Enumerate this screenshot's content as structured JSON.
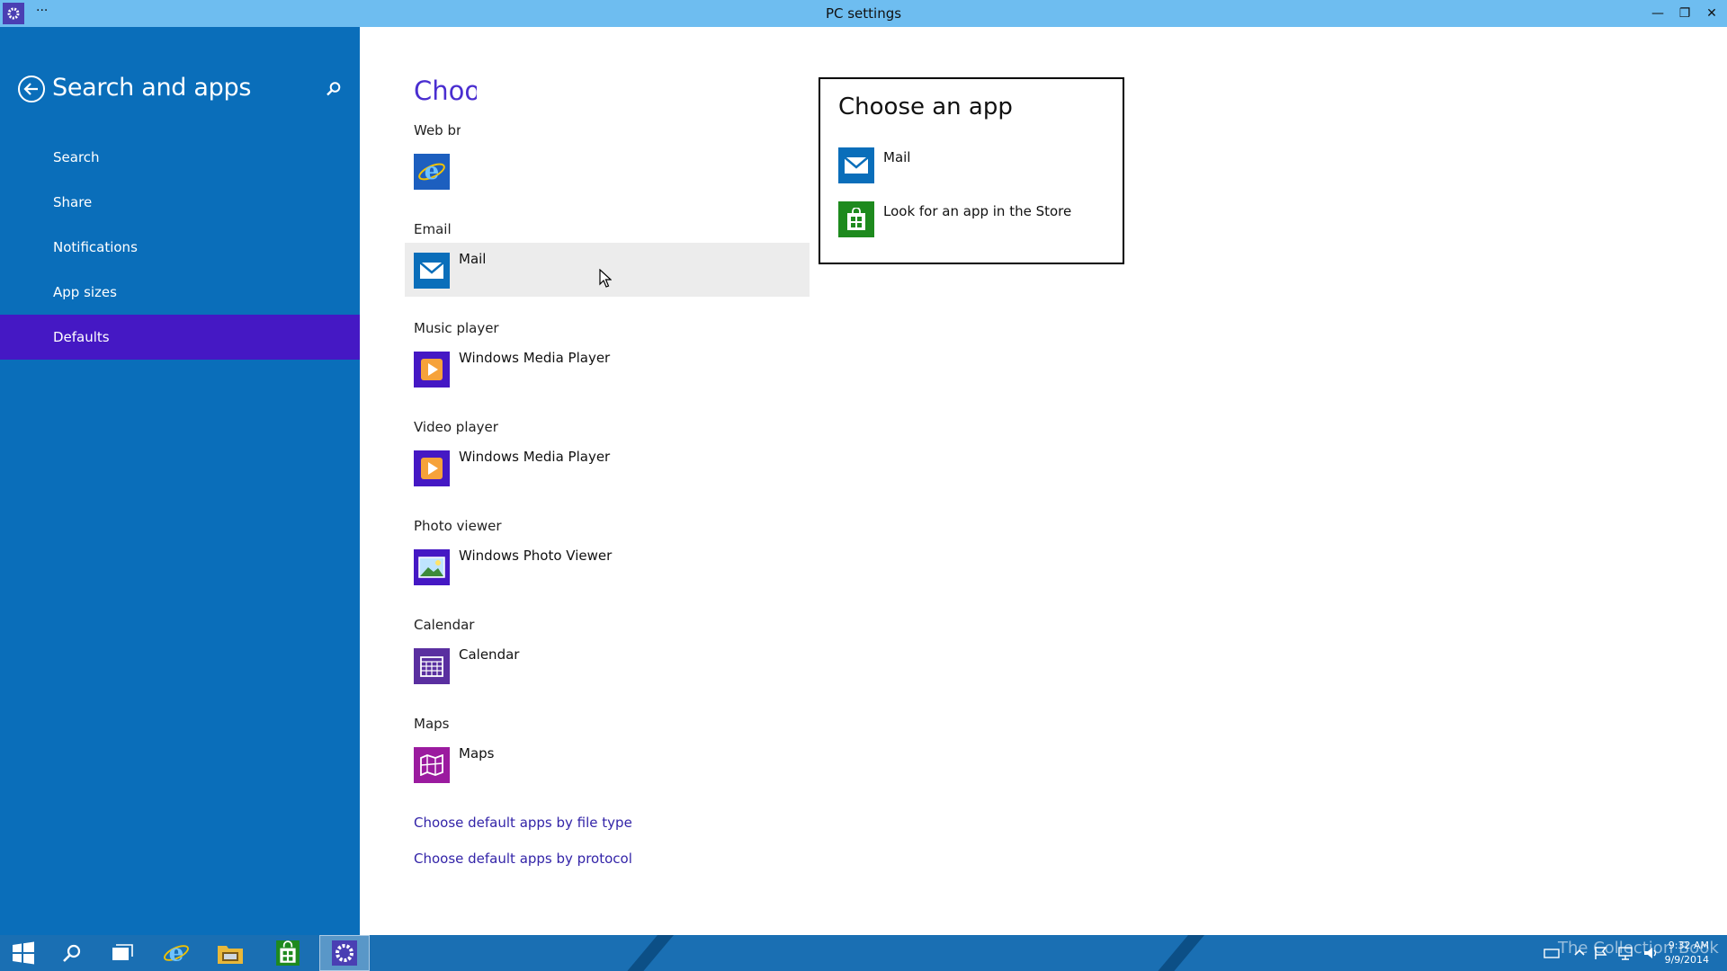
{
  "window": {
    "title": "PC settings",
    "menu_dots": "···",
    "controls": {
      "minimize": "—",
      "restore": "❐",
      "close": "✕"
    }
  },
  "sidebar": {
    "heading": "Search and apps",
    "items": [
      {
        "label": "Search"
      },
      {
        "label": "Share"
      },
      {
        "label": "Notifications"
      },
      {
        "label": "App sizes"
      },
      {
        "label": "Defaults"
      }
    ],
    "active_index": 4
  },
  "main": {
    "title": "Choose default apps",
    "sections": [
      {
        "label": "Web browser",
        "app": ""
      },
      {
        "label": "Email",
        "app": "Mail"
      },
      {
        "label": "Music player",
        "app": "Windows Media Player"
      },
      {
        "label": "Video player",
        "app": "Windows Media Player"
      },
      {
        "label": "Photo viewer",
        "app": "Windows Photo Viewer"
      },
      {
        "label": "Calendar",
        "app": "Calendar"
      },
      {
        "label": "Maps",
        "app": "Maps"
      }
    ],
    "links": [
      {
        "label": "Choose default apps by file type"
      },
      {
        "label": "Choose default apps by protocol"
      }
    ]
  },
  "flyout": {
    "title": "Choose an app",
    "options": [
      {
        "label": "Mail"
      },
      {
        "label": "Look for an app in the Store"
      }
    ]
  },
  "taskbar": {
    "time": "9:32 AM",
    "date": "9/9/2014",
    "watermark": "The Collection Book"
  },
  "colors": {
    "titlebar": "#6ebdf0",
    "sidebar": "#0a6eba",
    "sidebar_active": "#4518c4",
    "accent": "#4a2ed0",
    "link": "#3324a8",
    "taskbar": "#1a6fb3"
  }
}
